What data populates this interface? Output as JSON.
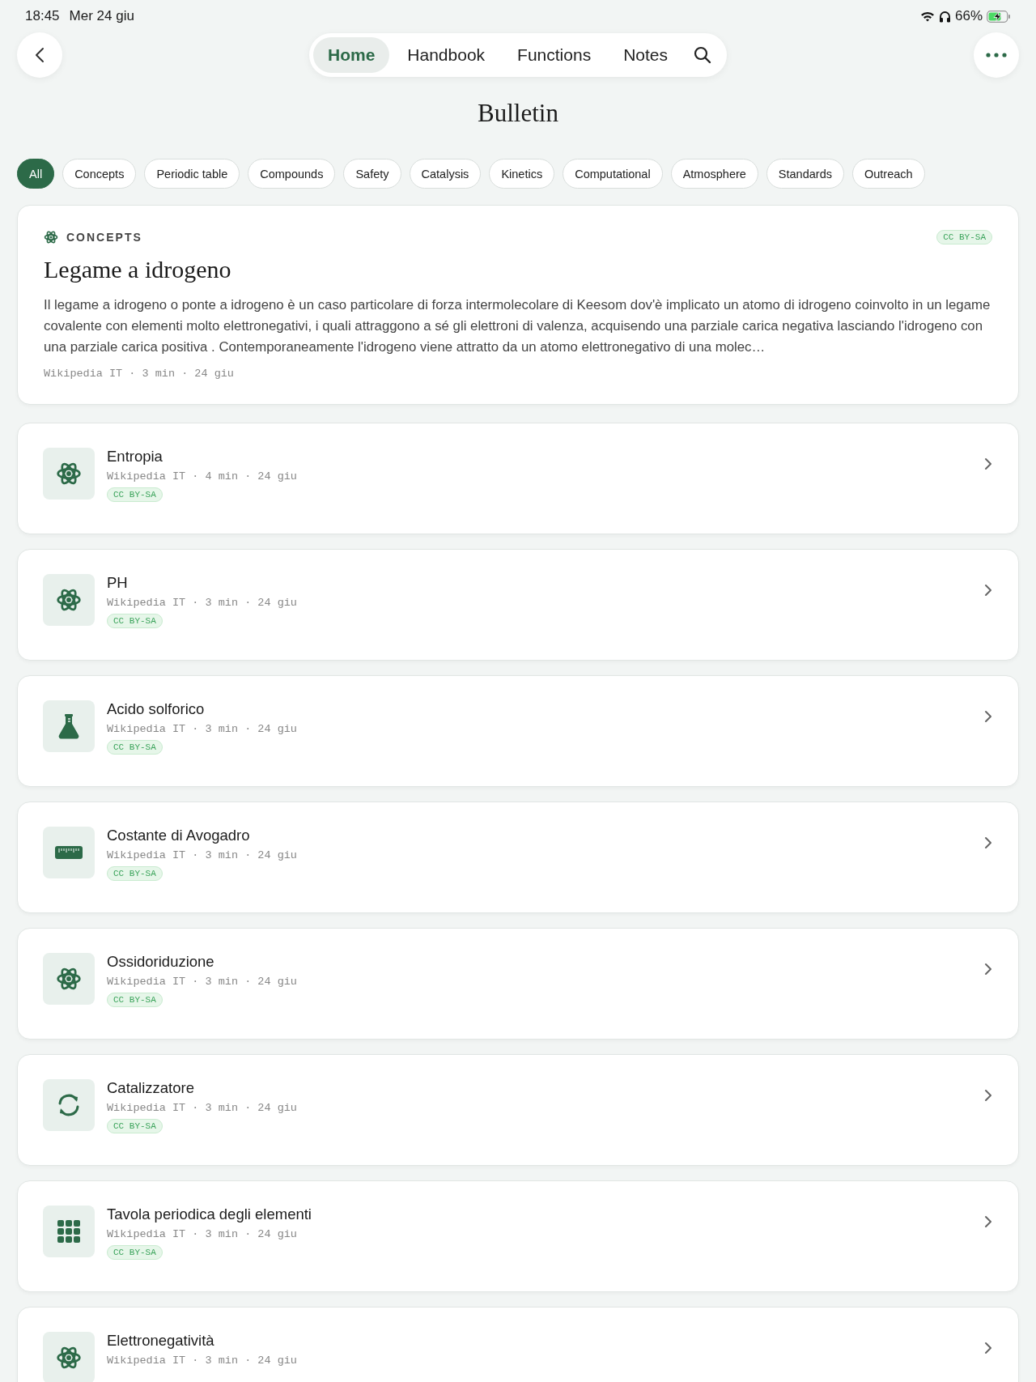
{
  "status_bar": {
    "time": "18:45",
    "date": "Mer 24 giu",
    "battery": "66%",
    "charging": true
  },
  "nav": {
    "tabs": [
      {
        "label": "Home",
        "selected": true
      },
      {
        "label": "Handbook",
        "selected": false
      },
      {
        "label": "Functions",
        "selected": false
      },
      {
        "label": "Notes",
        "selected": false
      }
    ]
  },
  "title": "Bulletin",
  "filters": [
    {
      "label": "All",
      "selected": true
    },
    {
      "label": "Concepts",
      "selected": false
    },
    {
      "label": "Periodic table",
      "selected": false
    },
    {
      "label": "Compounds",
      "selected": false
    },
    {
      "label": "Safety",
      "selected": false
    },
    {
      "label": "Catalysis",
      "selected": false
    },
    {
      "label": "Kinetics",
      "selected": false
    },
    {
      "label": "Computational",
      "selected": false
    },
    {
      "label": "Atmosphere",
      "selected": false
    },
    {
      "label": "Standards",
      "selected": false
    },
    {
      "label": "Outreach",
      "selected": false
    }
  ],
  "featured": {
    "category": "CONCEPTS",
    "license": "CC BY-SA",
    "title": "Legame a idrogeno",
    "excerpt": "Il legame a idrogeno o ponte a idrogeno è un caso particolare di forza intermolecolare di Keesom dov'è implicato un atomo di idrogeno coinvolto in un legame covalente con elementi molto elettronegativi, i quali attraggono a sé gli elettroni di valenza, acquisendo una parziale carica negativa lasciando l'idrogeno con una parziale carica positiva . Contemporaneamente l'idrogeno viene attratto da un atomo elettronegativo di una molec…",
    "meta": "Wikipedia IT · 3 min · 24 giu"
  },
  "articles": [
    {
      "kind": "atom",
      "title": "Entropia",
      "meta": "Wikipedia IT · 4 min · 24 giu",
      "license": "CC BY-SA"
    },
    {
      "kind": "atom",
      "title": "PH",
      "meta": "Wikipedia IT · 3 min · 24 giu",
      "license": "CC BY-SA"
    },
    {
      "kind": "flask",
      "title": "Acido solforico",
      "meta": "Wikipedia IT · 3 min · 24 giu",
      "license": "CC BY-SA"
    },
    {
      "kind": "ruler",
      "title": "Costante di Avogadro",
      "meta": "Wikipedia IT · 3 min · 24 giu",
      "license": "CC BY-SA"
    },
    {
      "kind": "atom",
      "title": "Ossidoriduzione",
      "meta": "Wikipedia IT · 3 min · 24 giu",
      "license": "CC BY-SA"
    },
    {
      "kind": "cycle",
      "title": "Catalizzatore",
      "meta": "Wikipedia IT · 3 min · 24 giu",
      "license": "CC BY-SA"
    },
    {
      "kind": "grid",
      "title": "Tavola periodica degli elementi",
      "meta": "Wikipedia IT · 3 min · 24 giu",
      "license": "CC BY-SA"
    },
    {
      "kind": "atom",
      "title": "Elettronegatività",
      "meta": "Wikipedia IT · 3 min · 24 giu"
    }
  ]
}
